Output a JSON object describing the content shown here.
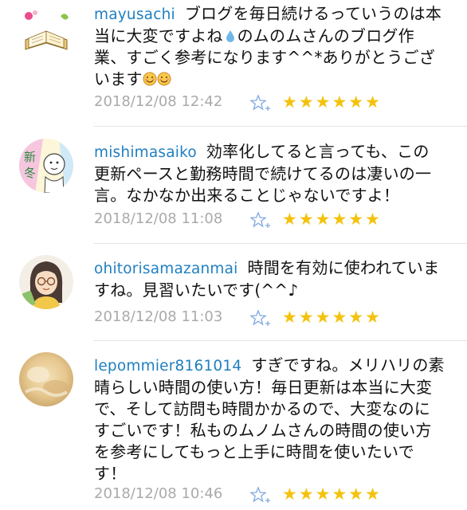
{
  "comments": [
    {
      "user": "mayusachi",
      "text_a": "ブログを毎日続けるっていうのは本当に大変ですよね",
      "text_b": "のムのムさんのブログ作業、すごく参考になります^^*ありがとうございます",
      "time": "2018/12/08 12:42",
      "stars": "★★★★★★",
      "avatar_icon": "book-flower-icon"
    },
    {
      "user": "mishimasaiko",
      "text": "効率化してると言っても、この更新ペースと勤務時間で続けてるのは凄いの一言。なかなか出来ることじゃないですよ！",
      "time": "2018/12/08 11:08",
      "stars": "★★★★★★",
      "avatar_label": "新冬",
      "avatar_icon": "character-drawing-icon"
    },
    {
      "user": "ohitorisamazanmai",
      "text": "時間を有効に使われていますね。見習いたいです(^^♪",
      "time": "2018/12/08 11:03",
      "stars": "★★★★★★",
      "avatar_icon": "woman-glasses-icon"
    },
    {
      "user": "lepommier8161014",
      "text": "すぎですね。メリハリの素晴らしい時間の使い方！毎日更新は本当に大変で、そして訪問も時間かかるので、大変なのにすごいです！私ものムノムさんの時間の使い方を参考にしてもっと上手に時間を使いたいです！",
      "time": "2018/12/08 10:46",
      "stars": "★★★★★★",
      "avatar_icon": "blurred-photo-icon"
    }
  ],
  "colors": {
    "username": "#1f7fc0",
    "timestamp": "#aaaaaa",
    "star": "#f4c20d",
    "add_star": "#7fa8e0"
  }
}
